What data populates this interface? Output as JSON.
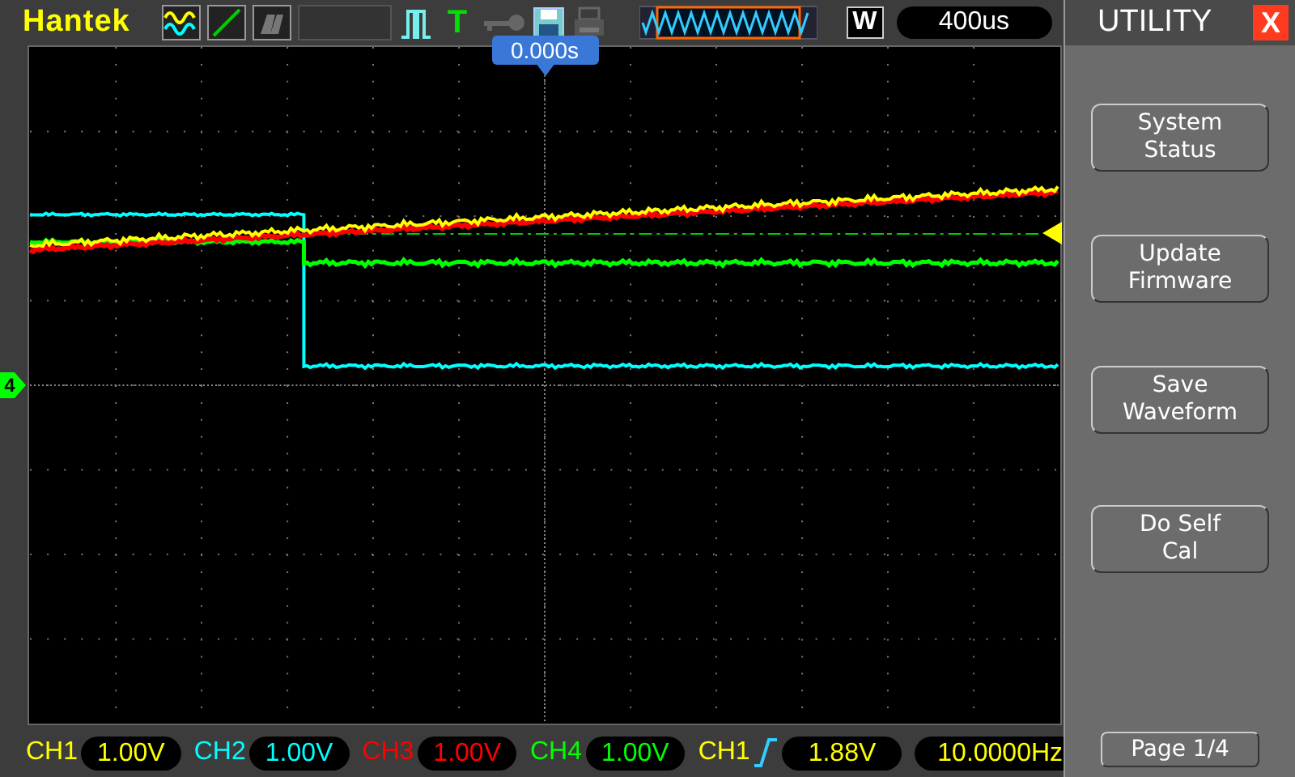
{
  "header": {
    "brand": "Hantek",
    "trigger_icon": "T",
    "mode_letter": "W",
    "timebase": "400us",
    "trigger_position": "0.000s"
  },
  "screen": {
    "ground_marker": "4"
  },
  "channels": [
    {
      "label": "CH1",
      "scale": "1.00V",
      "color": "#ffff00"
    },
    {
      "label": "CH2",
      "scale": "1.00V",
      "color": "#00ffff"
    },
    {
      "label": "CH3",
      "scale": "1.00V",
      "color": "#ff0000"
    },
    {
      "label": "CH4",
      "scale": "1.00V",
      "color": "#00ff00"
    }
  ],
  "trigger": {
    "source": "CH1",
    "level": "1.88V",
    "frequency": "10.0000Hz"
  },
  "panel": {
    "title": "UTILITY",
    "close": "X",
    "buttons": [
      "System Status",
      "Update Firmware",
      "Save Waveform",
      "Do Self Cal"
    ],
    "page": "Page 1/4"
  }
}
